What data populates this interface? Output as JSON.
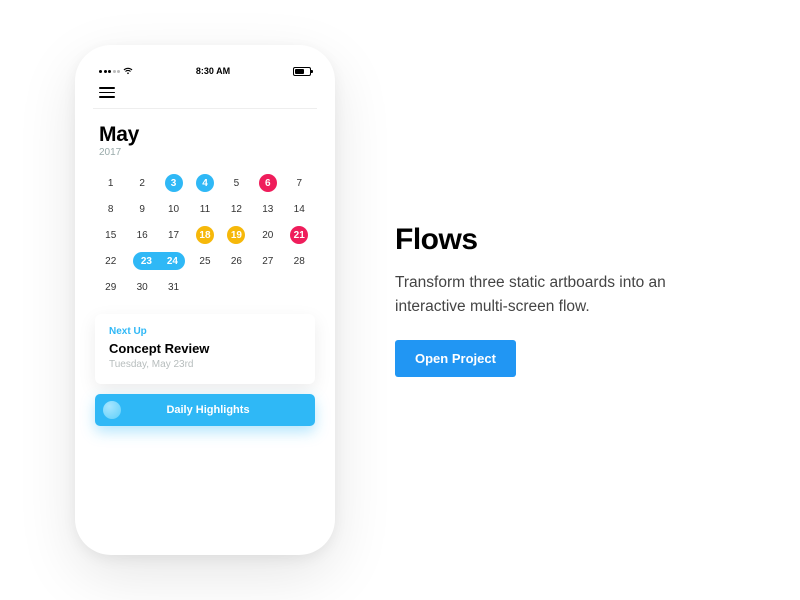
{
  "phone": {
    "status": {
      "carrier_dots": 5,
      "time": "8:30 AM"
    },
    "calendar": {
      "month": "May",
      "year": "2017",
      "weeks": [
        [
          1,
          2,
          3,
          4,
          5,
          6,
          7
        ],
        [
          8,
          9,
          10,
          11,
          12,
          13,
          14
        ],
        [
          15,
          16,
          17,
          18,
          19,
          20,
          21
        ],
        [
          22,
          23,
          24,
          25,
          26,
          27,
          28
        ],
        [
          29,
          30,
          31,
          null,
          null,
          null,
          null
        ]
      ],
      "marks": {
        "3": "blue",
        "4": "blue",
        "6": "pink",
        "18": "amber",
        "19": "amber",
        "21": "pink"
      },
      "range": {
        "start": 23,
        "end": 24,
        "color": "blue"
      }
    },
    "next_up": {
      "label": "Next Up",
      "title": "Concept Review",
      "date": "Tuesday, May 23rd"
    },
    "highlights_button": "Daily Highlights"
  },
  "copy": {
    "heading": "Flows",
    "body": "Transform three static artboards into an interactive multi-screen flow.",
    "cta": "Open Project"
  }
}
